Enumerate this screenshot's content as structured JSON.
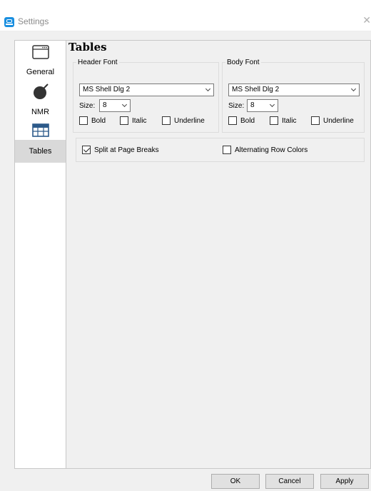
{
  "window": {
    "title": "Settings",
    "close_glyph": "✕"
  },
  "sidebar": {
    "items": [
      {
        "label": "",
        "icon": "window-icon"
      },
      {
        "label": "General",
        "icon": "molecule-icon"
      },
      {
        "label": "NMR",
        "icon": "table-icon"
      },
      {
        "label": "Tables",
        "active": true
      }
    ]
  },
  "page": {
    "title": "Tables"
  },
  "header_font": {
    "legend": "Header Font",
    "font": "MS Shell Dlg 2",
    "size_label": "Size:",
    "size": "8",
    "bold": "Bold",
    "italic": "Italic",
    "underline": "Underline"
  },
  "body_font": {
    "legend": "Body Font",
    "font": "MS Shell Dlg 2",
    "size_label": "Size:",
    "size": "8",
    "bold": "Bold",
    "italic": "Italic",
    "underline": "Underline"
  },
  "options": {
    "split": {
      "label": "Split at Page Breaks",
      "checked": true
    },
    "alternating": {
      "label": "Alternating Row Colors",
      "checked": false
    }
  },
  "buttons": {
    "ok": "OK",
    "cancel": "Cancel",
    "apply": "Apply"
  },
  "colors": {
    "accent": "#1a8fe0",
    "selected_item": "#d9d9d9"
  }
}
